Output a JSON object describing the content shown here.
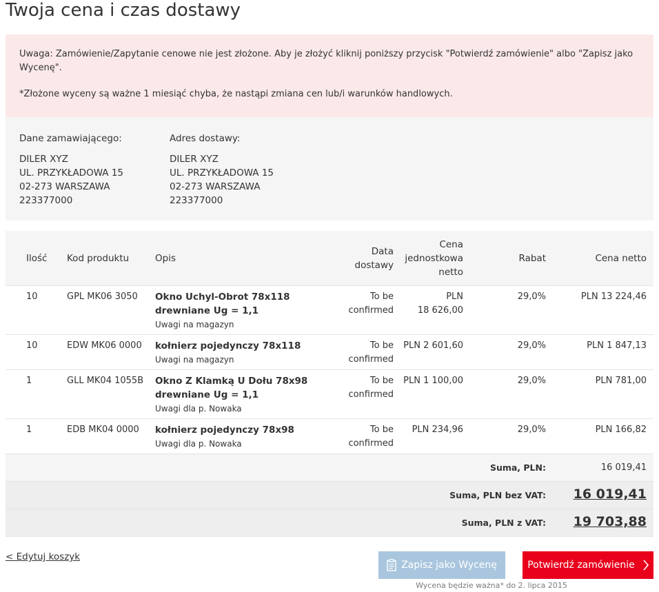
{
  "page_title": "Twoja cena i czas dostawy",
  "alert": {
    "line1": "Uwaga: Zamówienie/Zapytanie cenowe nie jest złożone. Aby je złożyć kliknij poniższy przycisk \"Potwierdź zamówienie\" albo \"Zapisz jako Wycenę\".",
    "line2": "*Złożone wyceny są ważne 1 miesiąć chyba, że nastąpi zmiana cen lub/i warunków handlowych."
  },
  "orderer": {
    "heading": "Dane zamawiającego:",
    "name": "DILER XYZ",
    "street": "UL. PRZYKŁADOWA 15",
    "city": "02-273 WARSZAWA",
    "phone": "223377000"
  },
  "delivery": {
    "heading": "Adres dostawy:",
    "name": "DILER XYZ",
    "street": "UL. PRZYKŁADOWA 15",
    "city": "02-273 WARSZAWA",
    "phone": "223377000"
  },
  "table": {
    "headers": {
      "qty": "Ilość",
      "code": "Kod produktu",
      "desc": "Opis",
      "date_1": "Data",
      "date_2": "dostawy",
      "unit_1": "Cena",
      "unit_2": "jednostkowa",
      "unit_3": "netto",
      "rabat": "Rabat",
      "net": "Cena netto"
    },
    "rows": [
      {
        "qty": "10",
        "code": "GPL MK06 3050",
        "title_1": "Okno Uchyl-Obrot 78x118",
        "title_2": "drewniane Ug = 1,1",
        "note": "Uwagi na magazyn",
        "date_1": "To be",
        "date_2": "confirmed",
        "unit_1": "PLN",
        "unit_2": "18 626,00",
        "rabat": "29,0%",
        "net": "PLN 13 224,46"
      },
      {
        "qty": "10",
        "code": "EDW MK06 0000",
        "title_1": "kołnierz pojedynczy 78x118",
        "title_2": "",
        "note": "Uwagi na magazyn",
        "date_1": "To be",
        "date_2": "confirmed",
        "unit_1": "PLN 2 601,60",
        "unit_2": "",
        "rabat": "29,0%",
        "net": "PLN 1 847,13"
      },
      {
        "qty": "1",
        "code": "GLL MK04 1055B",
        "title_1": "Okno Z Klamką U Dołu 78x98",
        "title_2": "drewniane Ug = 1,1",
        "note": "Uwagi dla p. Nowaka",
        "date_1": "To be",
        "date_2": "confirmed",
        "unit_1": "PLN 1 100,00",
        "unit_2": "",
        "rabat": "29,0%",
        "net": "PLN 781,00"
      },
      {
        "qty": "1",
        "code": "EDB MK04 0000",
        "title_1": "kołnierz pojedynczy 78x98",
        "title_2": "",
        "note": "Uwagi dla p. Nowaka",
        "date_1": "To be",
        "date_2": "confirmed",
        "unit_1": "PLN 234,96",
        "unit_2": "",
        "rabat": "29,0%",
        "net": "PLN 166,82"
      }
    ]
  },
  "totals": {
    "sum_label": "Suma, PLN:",
    "sum_value": "16 019,41",
    "net_label": "Suma, PLN bez VAT:",
    "net_value": "16 019,41",
    "gross_label": "Suma, PLN z VAT:",
    "gross_value": "19 703,88"
  },
  "actions": {
    "edit_cart": "< Edytuj koszyk",
    "save_quote": "Zapisz jako Wycenę",
    "confirm_order": "Potwierdź zamówienie",
    "validity_note": "Wycena będzie ważna* do 2. lipca 2015"
  },
  "colors": {
    "alert_bg": "#fbe9ea",
    "confirm_button": "#e8001c",
    "quote_button": "#a9c6de"
  },
  "icons": {
    "quote": "clipboard-icon",
    "confirm": "chevron-right-icon"
  }
}
